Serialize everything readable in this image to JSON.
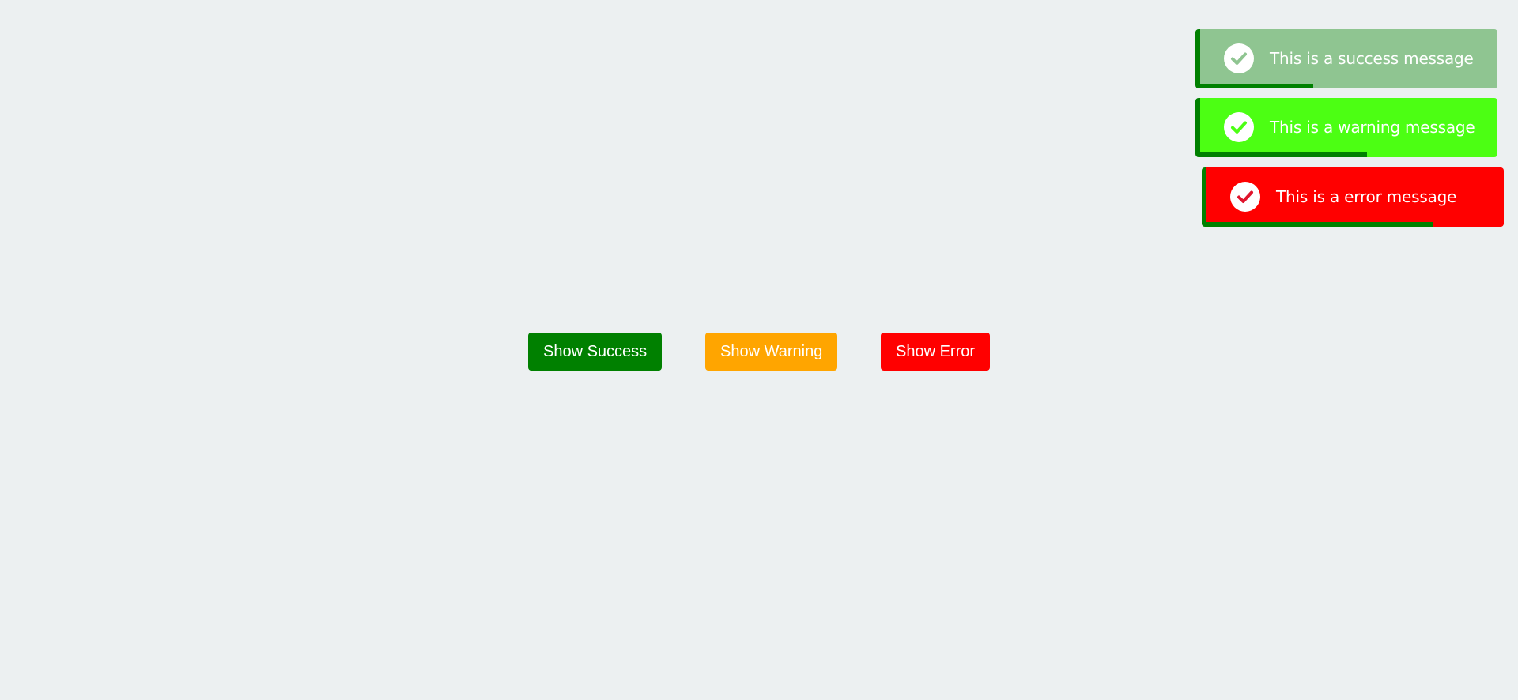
{
  "buttons": {
    "success": {
      "label": "Show Success",
      "color": "#008000"
    },
    "warning": {
      "label": "Show Warning",
      "color": "#ffa500"
    },
    "error": {
      "label": "Show Error",
      "color": "#ff0000"
    }
  },
  "toasts": [
    {
      "id": "success",
      "message": "This is a success message",
      "background": "#8fc591",
      "icon": "check-icon",
      "icon_color": "#8fc591",
      "progress": 0.38
    },
    {
      "id": "warning",
      "message": "This is a warning message",
      "background": "#4cff13",
      "icon": "check-icon",
      "icon_color": "#4cff13",
      "progress": 0.56
    },
    {
      "id": "error",
      "message": "This is a error message",
      "background": "#ff0000",
      "icon": "check-icon",
      "icon_color": "#e0142c",
      "progress": 0.76
    }
  ],
  "colors": {
    "page_background": "#ecf0f1",
    "toast_accent": "#008000"
  }
}
